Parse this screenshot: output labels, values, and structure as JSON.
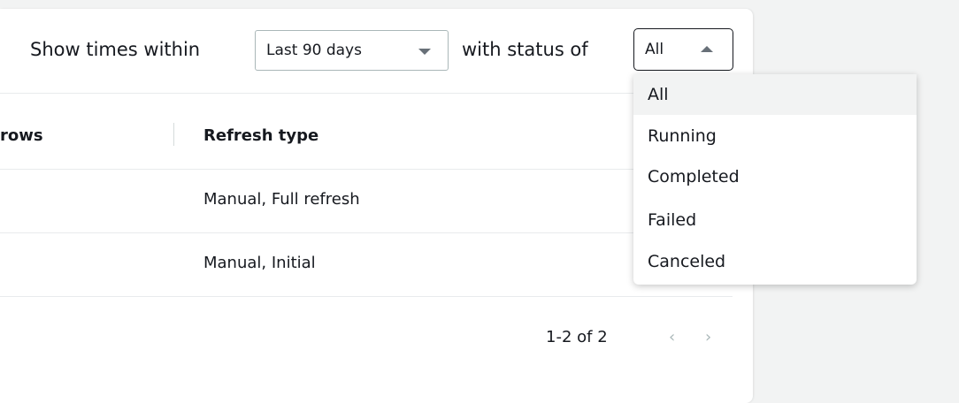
{
  "filters": {
    "prefix_text": "Show times within",
    "time_range": {
      "selected": "Last 90 days"
    },
    "middle_text": "with status of",
    "status": {
      "selected": "All"
    }
  },
  "table": {
    "columns": [
      "rows",
      "Refresh type"
    ],
    "rows": [
      {
        "rows": "",
        "refresh_type": "Manual, Full refresh"
      },
      {
        "rows": "",
        "refresh_type": "Manual, Initial"
      }
    ]
  },
  "pagination": {
    "summary": "1-2 of 2",
    "prev_glyph": "‹",
    "next_glyph": "›"
  },
  "status_dropdown": {
    "options": [
      "All",
      "Running",
      "Completed",
      "Failed",
      "Canceled"
    ],
    "selected_index": 0
  },
  "colors": {
    "background": "#f2f3f3",
    "card": "#ffffff",
    "text": "#16191f",
    "muted_icon": "#687078",
    "border": "#aab7b8"
  }
}
